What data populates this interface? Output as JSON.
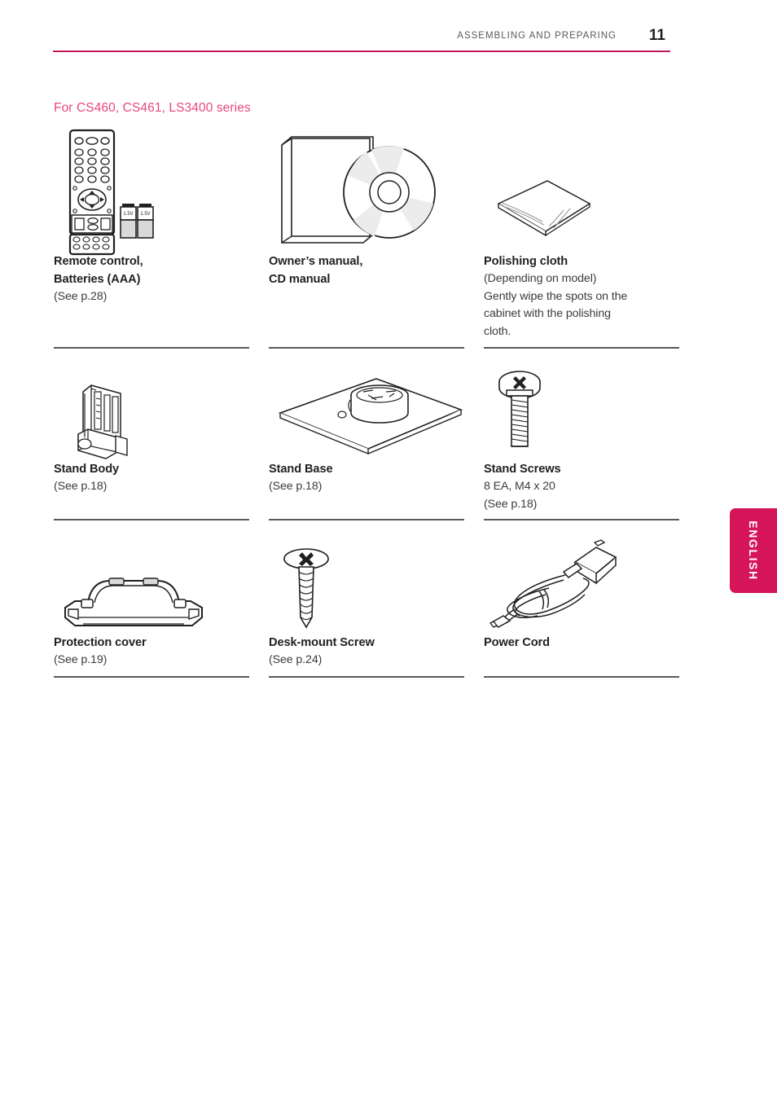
{
  "header": {
    "title": "ASSEMBLING AND PREPARING",
    "page_number": "11",
    "rule_color": "#c2185b"
  },
  "section": {
    "title": "For CS460, CS461, LS3400 series",
    "title_color": "#e8487f"
  },
  "side_tab": {
    "label": "ENGLISH",
    "color": "#d6145a"
  },
  "accessories": [
    {
      "icon": "remote-control-batteries-icon",
      "title_line1": "Remote control,",
      "title_line2": "Batteries (AAA)",
      "note1": "(See p.28)",
      "note2": "",
      "note3": "",
      "note4": "",
      "battery_label": "1.5V"
    },
    {
      "icon": "owners-manual-cd-icon",
      "title_line1": "Owner’s manual,",
      "title_line2": "CD manual",
      "note1": "",
      "note2": "",
      "note3": "",
      "note4": ""
    },
    {
      "icon": "polishing-cloth-icon",
      "title_line1": "Polishing cloth",
      "title_line2": "",
      "note1": "(Depending on model)",
      "note2": "Gently wipe the spots on the",
      "note3": "cabinet with the polishing",
      "note4": "cloth."
    },
    {
      "icon": "stand-body-icon",
      "title_line1": "Stand Body",
      "title_line2": "",
      "note1": "(See p.18)",
      "note2": "",
      "note3": "",
      "note4": ""
    },
    {
      "icon": "stand-base-icon",
      "title_line1": "Stand Base",
      "title_line2": "",
      "note1": "(See p.18)",
      "note2": "",
      "note3": "",
      "note4": ""
    },
    {
      "icon": "stand-screws-icon",
      "title_line1": "Stand Screws",
      "title_line2": "",
      "note1": "8 EA, M4 x 20",
      "note2": "(See p.18)",
      "note3": "",
      "note4": ""
    },
    {
      "icon": "protection-cover-icon",
      "title_line1": "Protection cover",
      "title_line2": "",
      "note1": "(See p.19)",
      "note2": "",
      "note3": "",
      "note4": ""
    },
    {
      "icon": "desk-mount-screw-icon",
      "title_line1": "Desk-mount Screw",
      "title_line2": "",
      "note1": "(See p.24)",
      "note2": "",
      "note3": "",
      "note4": ""
    },
    {
      "icon": "power-cord-icon",
      "title_line1": "Power Cord",
      "title_line2": "",
      "note1": "",
      "note2": "",
      "note3": "",
      "note4": ""
    }
  ]
}
